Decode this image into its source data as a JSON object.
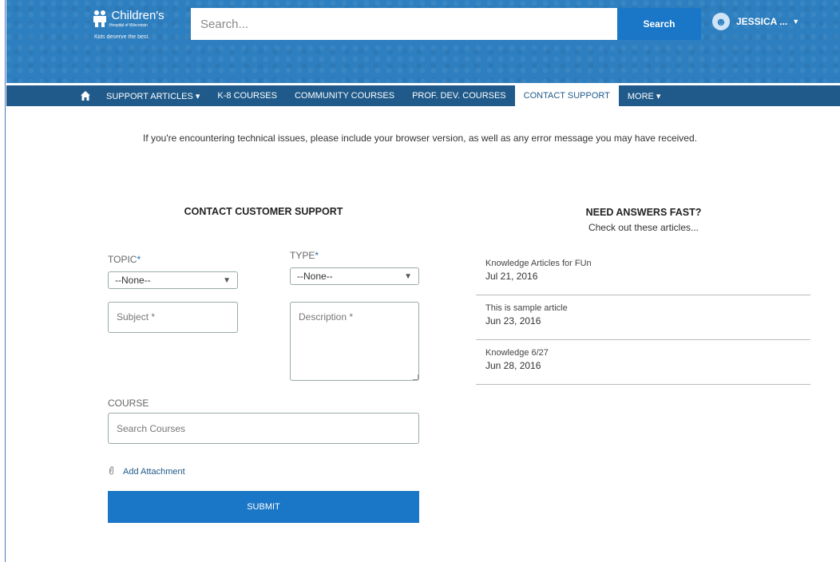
{
  "header": {
    "logo_name": "Children's",
    "logo_sub": "Hospital of Wisconsin",
    "logo_tagline": "Kids deserve the best.",
    "search_placeholder": "Search...",
    "search_button": "Search",
    "user_name": "JESSICA ..."
  },
  "nav": {
    "items": [
      {
        "label": "SUPPORT ARTICLES ▾"
      },
      {
        "label": "K-8 COURSES"
      },
      {
        "label": "COMMUNITY COURSES"
      },
      {
        "label": "PROF. DEV. COURSES"
      },
      {
        "label": "CONTACT SUPPORT"
      },
      {
        "label": "MORE ▾"
      }
    ]
  },
  "notice": "If you're encountering technical issues, please include your browser version, as well as any error message you may have received.",
  "form": {
    "title": "CONTACT CUSTOMER SUPPORT",
    "topic_label": "TOPIC",
    "topic_value": "--None--",
    "type_label": "TYPE",
    "type_value": "--None--",
    "required_mark": "*",
    "subject_placeholder": "Subject *",
    "description_placeholder": "Description *",
    "course_label": "COURSE",
    "course_placeholder": "Search Courses",
    "attachment_label": "Add Attachment",
    "submit_label": "SUBMIT"
  },
  "side": {
    "title": "NEED ANSWERS FAST?",
    "subtitle": "Check out these articles...",
    "articles": [
      {
        "title": "Knowledge Articles for FUn",
        "date": "Jul 21, 2016"
      },
      {
        "title": "This is sample article",
        "date": "Jun 23, 2016"
      },
      {
        "title": "Knowledge 6/27",
        "date": "Jun 28, 2016"
      }
    ]
  },
  "colors": {
    "header_blue": "#2e7fc0",
    "nav_blue": "#1f5a8a",
    "button_blue": "#1a76c7"
  }
}
